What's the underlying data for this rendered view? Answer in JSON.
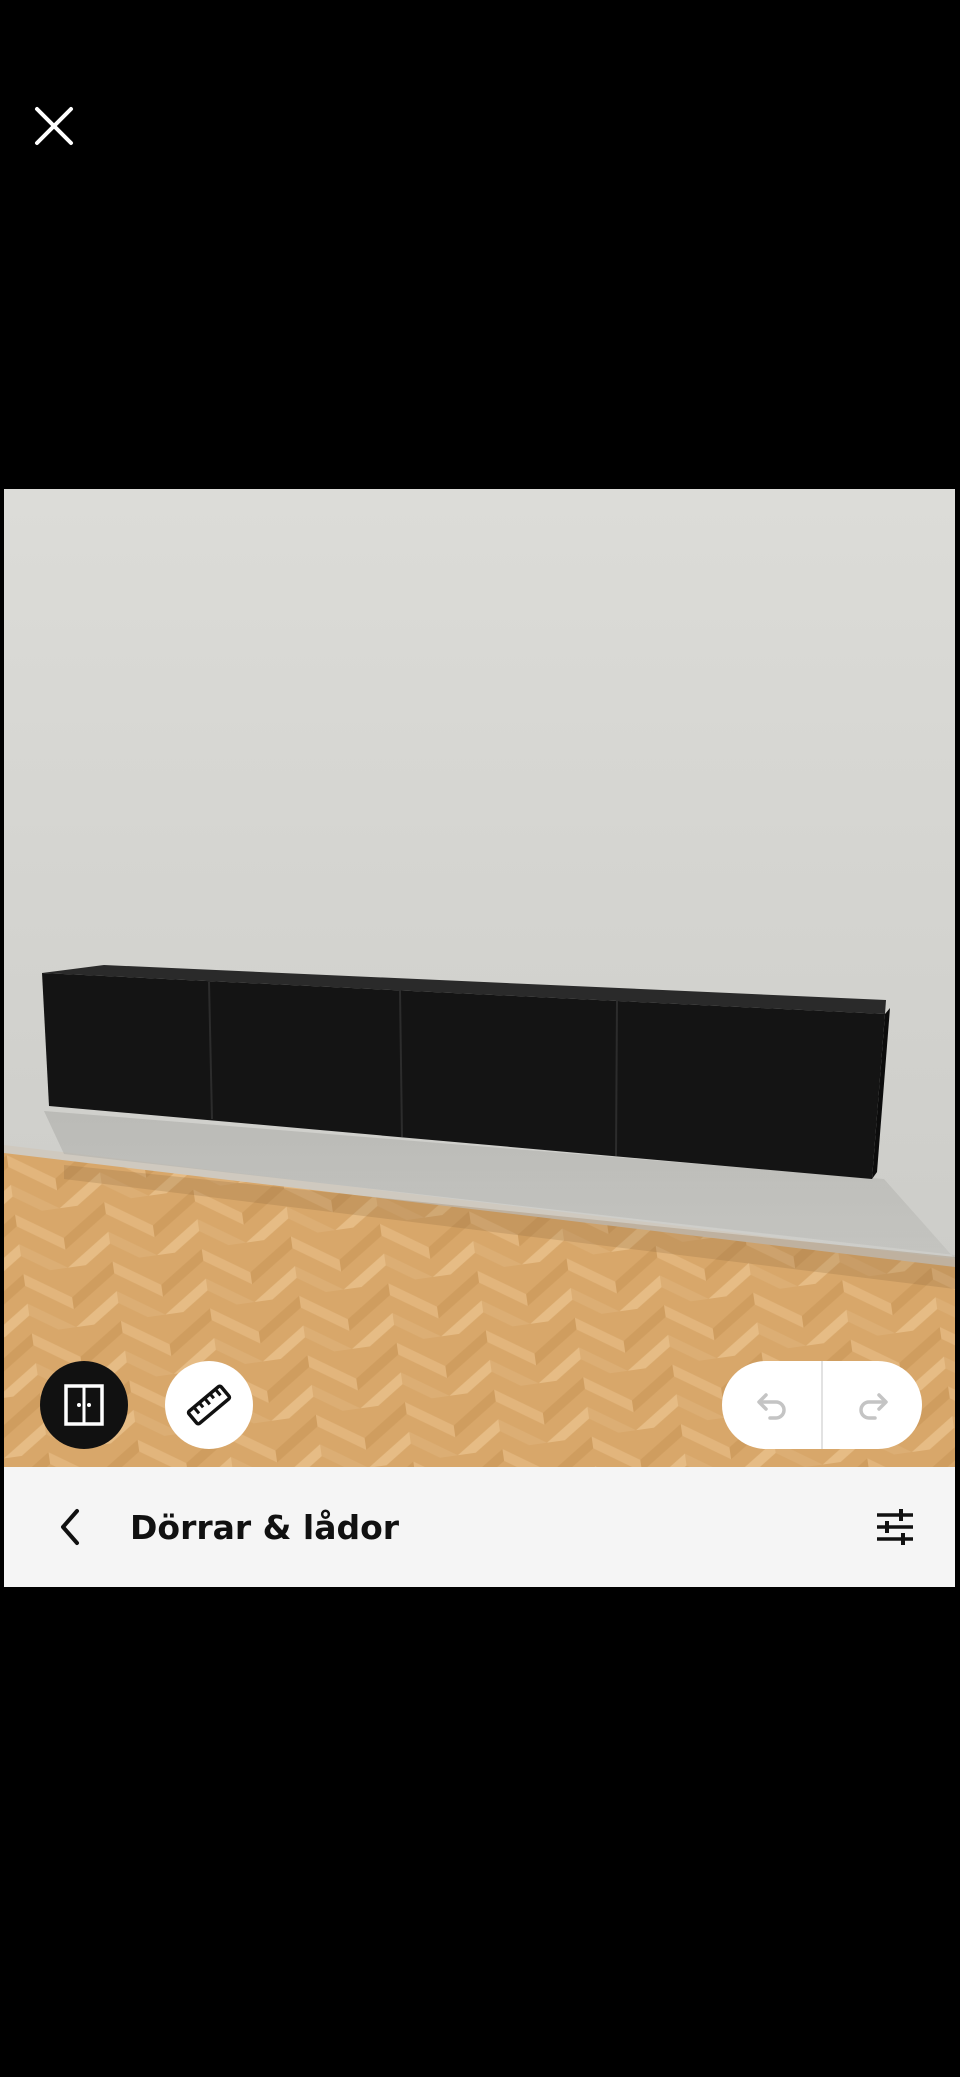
{
  "top": {
    "close_icon": "close-icon"
  },
  "scene": {
    "wall_color": "#d8d8d4",
    "floor_color": "#d9a86b",
    "cabinet_color": "#141414",
    "cabinet_door_count": 4
  },
  "toolbar": {
    "doors_icon": "doors-toggle-icon",
    "measure_icon": "ruler-icon",
    "undo_icon": "undo-icon",
    "redo_icon": "redo-icon"
  },
  "bottom_bar": {
    "title": "Dörrar & lådor",
    "back_icon": "chevron-left-icon",
    "filter_icon": "filter-sliders-icon"
  }
}
